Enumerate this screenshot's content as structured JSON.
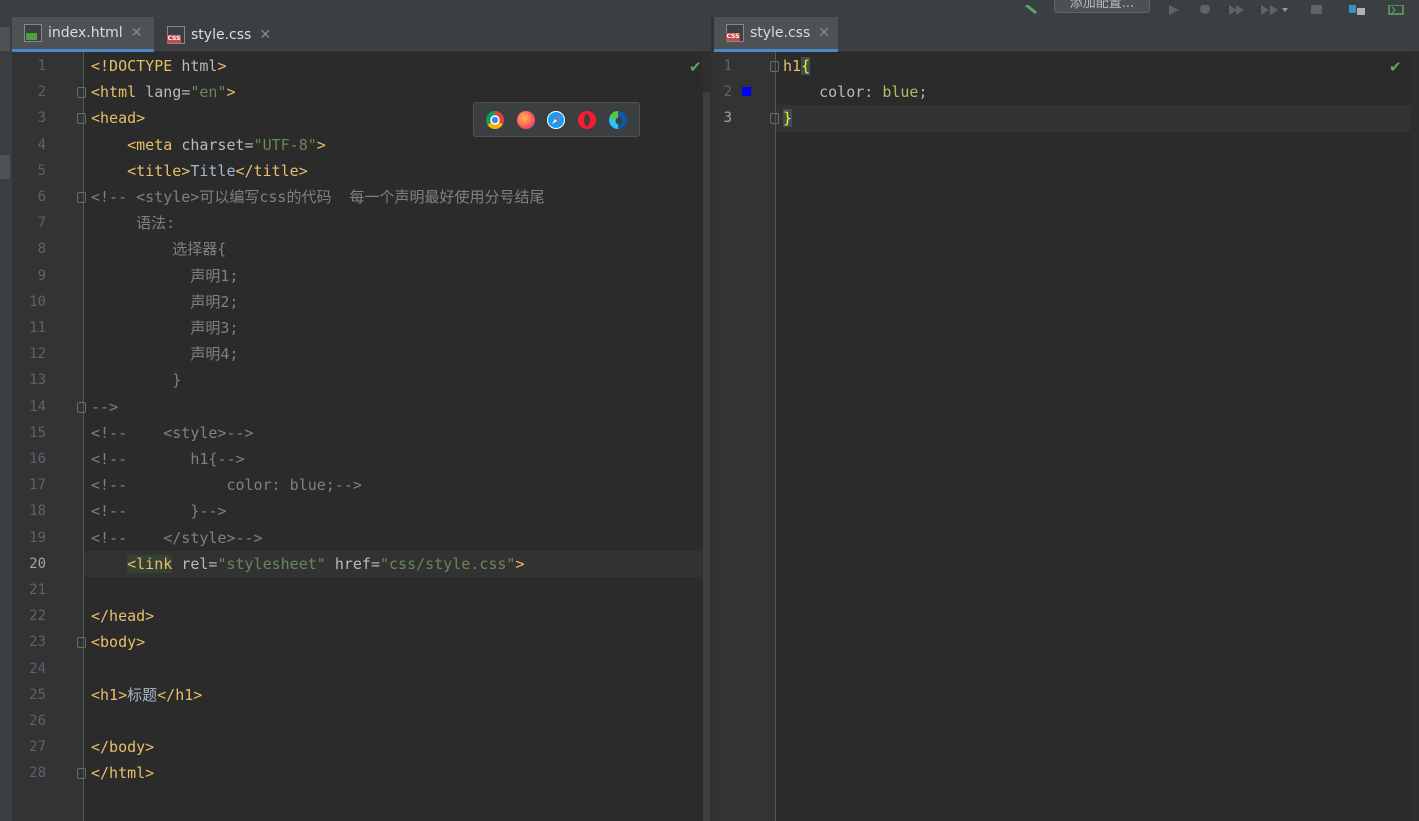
{
  "toolbar": {
    "config_button_label": "添加配置..."
  },
  "left_tabs": [
    {
      "label": "index.html",
      "icon": "html-file-icon",
      "active": true
    },
    {
      "label": "style.css",
      "icon": "css-file-icon",
      "active": false
    }
  ],
  "right_tabs": [
    {
      "label": "style.css",
      "icon": "css-file-icon",
      "active": true
    }
  ],
  "left_editor": {
    "current_line": 20,
    "line_numbers": [
      "1",
      "2",
      "3",
      "4",
      "5",
      "6",
      "7",
      "8",
      "9",
      "10",
      "11",
      "12",
      "13",
      "14",
      "15",
      "16",
      "17",
      "18",
      "19",
      "20",
      "21",
      "22",
      "23",
      "24",
      "25",
      "26",
      "27",
      "28"
    ],
    "lines": [
      [
        [
          "t-doc",
          "<!DOCTYPE "
        ],
        [
          "t-attr",
          "html"
        ],
        [
          "t-doc",
          ">"
        ]
      ],
      [
        [
          "t-tag",
          "<html "
        ],
        [
          "t-attr",
          "lang"
        ],
        [
          "t-txt",
          "="
        ],
        [
          "t-val",
          "\"en\""
        ],
        [
          "t-tag",
          ">"
        ]
      ],
      [
        [
          "t-tag",
          "<head>"
        ]
      ],
      [
        [
          "t-txt",
          "    "
        ],
        [
          "t-tag",
          "<meta "
        ],
        [
          "t-attr",
          "charset"
        ],
        [
          "t-txt",
          "="
        ],
        [
          "t-val",
          "\"UTF-8\""
        ],
        [
          "t-tag",
          ">"
        ]
      ],
      [
        [
          "t-txt",
          "    "
        ],
        [
          "t-tag",
          "<title>"
        ],
        [
          "t-txt",
          "Title"
        ],
        [
          "t-tag",
          "</title>"
        ]
      ],
      [
        [
          "t-com",
          "<!-- <style>可以编写css的代码  每一个声明最好使用分号结尾"
        ]
      ],
      [
        [
          "t-com",
          "     语法:"
        ]
      ],
      [
        [
          "t-com",
          "         选择器{"
        ]
      ],
      [
        [
          "t-com",
          "           声明1;"
        ]
      ],
      [
        [
          "t-com",
          "           声明2;"
        ]
      ],
      [
        [
          "t-com",
          "           声明3;"
        ]
      ],
      [
        [
          "t-com",
          "           声明4;"
        ]
      ],
      [
        [
          "t-com",
          "         }"
        ]
      ],
      [
        [
          "t-com",
          "-->"
        ]
      ],
      [
        [
          "t-com",
          "<!--    <style>-->"
        ]
      ],
      [
        [
          "t-com",
          "<!--       h1{-->"
        ]
      ],
      [
        [
          "t-com",
          "<!--           color: blue;-->"
        ]
      ],
      [
        [
          "t-com",
          "<!--       }-->"
        ]
      ],
      [
        [
          "t-com",
          "<!--    </style>-->"
        ]
      ],
      [
        [
          "t-txt",
          "    "
        ],
        [
          "t-tag hl-link",
          "<link"
        ],
        [
          "t-txt",
          " "
        ],
        [
          "t-attr",
          "rel"
        ],
        [
          "t-txt",
          "="
        ],
        [
          "t-val",
          "\"stylesheet\""
        ],
        [
          "t-txt",
          " "
        ],
        [
          "t-attr",
          "href"
        ],
        [
          "t-txt",
          "="
        ],
        [
          "t-val",
          "\"css/style.css\""
        ],
        [
          "t-tag",
          ">"
        ]
      ],
      [],
      [
        [
          "t-tag",
          "</head>"
        ]
      ],
      [
        [
          "t-tag",
          "<body>"
        ]
      ],
      [],
      [
        [
          "t-tag",
          "<h1>"
        ],
        [
          "t-txt",
          "标题"
        ],
        [
          "t-tag",
          "</h1>"
        ]
      ],
      [],
      [
        [
          "t-tag",
          "</body>"
        ]
      ],
      [
        [
          "t-tag",
          "</html>"
        ]
      ]
    ]
  },
  "right_editor": {
    "current_line": 3,
    "line_numbers": [
      "1",
      "2",
      "3"
    ],
    "lines": [
      [
        [
          "t-sel",
          "h1"
        ],
        [
          "t-brace",
          "{"
        ]
      ],
      [
        [
          "t-txt",
          "    "
        ],
        [
          "t-prop",
          "color"
        ],
        [
          "t-txt",
          ": "
        ],
        [
          "t-cval",
          "blue"
        ],
        [
          "t-txt",
          ";"
        ]
      ],
      [
        [
          "t-brace",
          "}"
        ]
      ]
    ]
  },
  "browsers": [
    "chrome-icon",
    "firefox-icon",
    "safari-icon",
    "opera-icon",
    "edge-icon"
  ],
  "colors": {
    "background": "#2b2b2b",
    "tag": "#e8bf6a",
    "string": "#6a8759",
    "comment": "#808080",
    "accent": "#4a88c7"
  }
}
